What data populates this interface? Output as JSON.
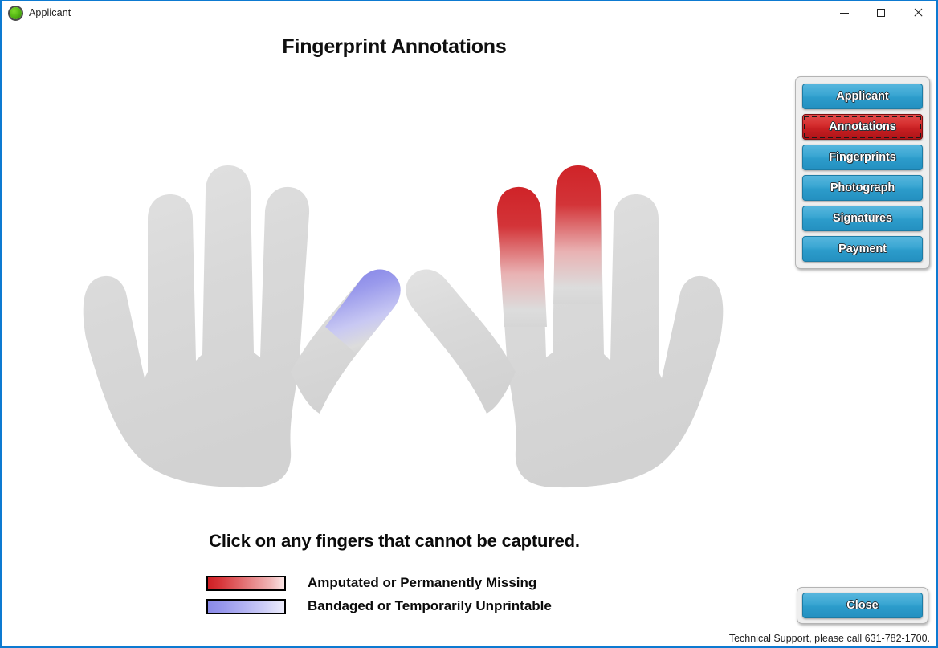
{
  "window": {
    "title": "Applicant",
    "icon": "green-circle-icon",
    "controls": {
      "minimize": "minimize-icon",
      "maximize": "maximize-icon",
      "close": "close-icon"
    },
    "accent_color": "#0d7ad1"
  },
  "page": {
    "title": "Fingerprint Annotations",
    "instruction": "Click on any fingers that cannot be captured."
  },
  "legend": {
    "items": [
      {
        "label": "Amputated or Permanently Missing",
        "swatch": "red-gradient",
        "color_from": "#cf1f24",
        "color_to": "#fbe6e6"
      },
      {
        "label": "Bandaged or Temporarily Unprintable",
        "swatch": "blue-gradient",
        "color_from": "#8a8ae8",
        "color_to": "#ececfb"
      }
    ]
  },
  "nav": {
    "items": [
      {
        "label": "Applicant",
        "active": false
      },
      {
        "label": "Annotations",
        "active": true
      },
      {
        "label": "Fingerprints",
        "active": false
      },
      {
        "label": "Photograph",
        "active": false
      },
      {
        "label": "Signatures",
        "active": false
      },
      {
        "label": "Payment",
        "active": false
      }
    ],
    "button_color": "#2c9ccb",
    "active_color": "#c71f22"
  },
  "footer": {
    "close_label": "Close",
    "support_text": "Technical Support, please call 631-782-1700."
  },
  "hands": {
    "hand_color": "#d6d6d6",
    "annotations": [
      {
        "hand": "left",
        "finger": "thumb",
        "state": "bandaged",
        "color": "#8a8ae8"
      },
      {
        "hand": "right",
        "finger": "index",
        "state": "amputated",
        "color": "#cf2328"
      },
      {
        "hand": "right",
        "finger": "middle",
        "state": "amputated",
        "color": "#cf2328"
      }
    ]
  }
}
